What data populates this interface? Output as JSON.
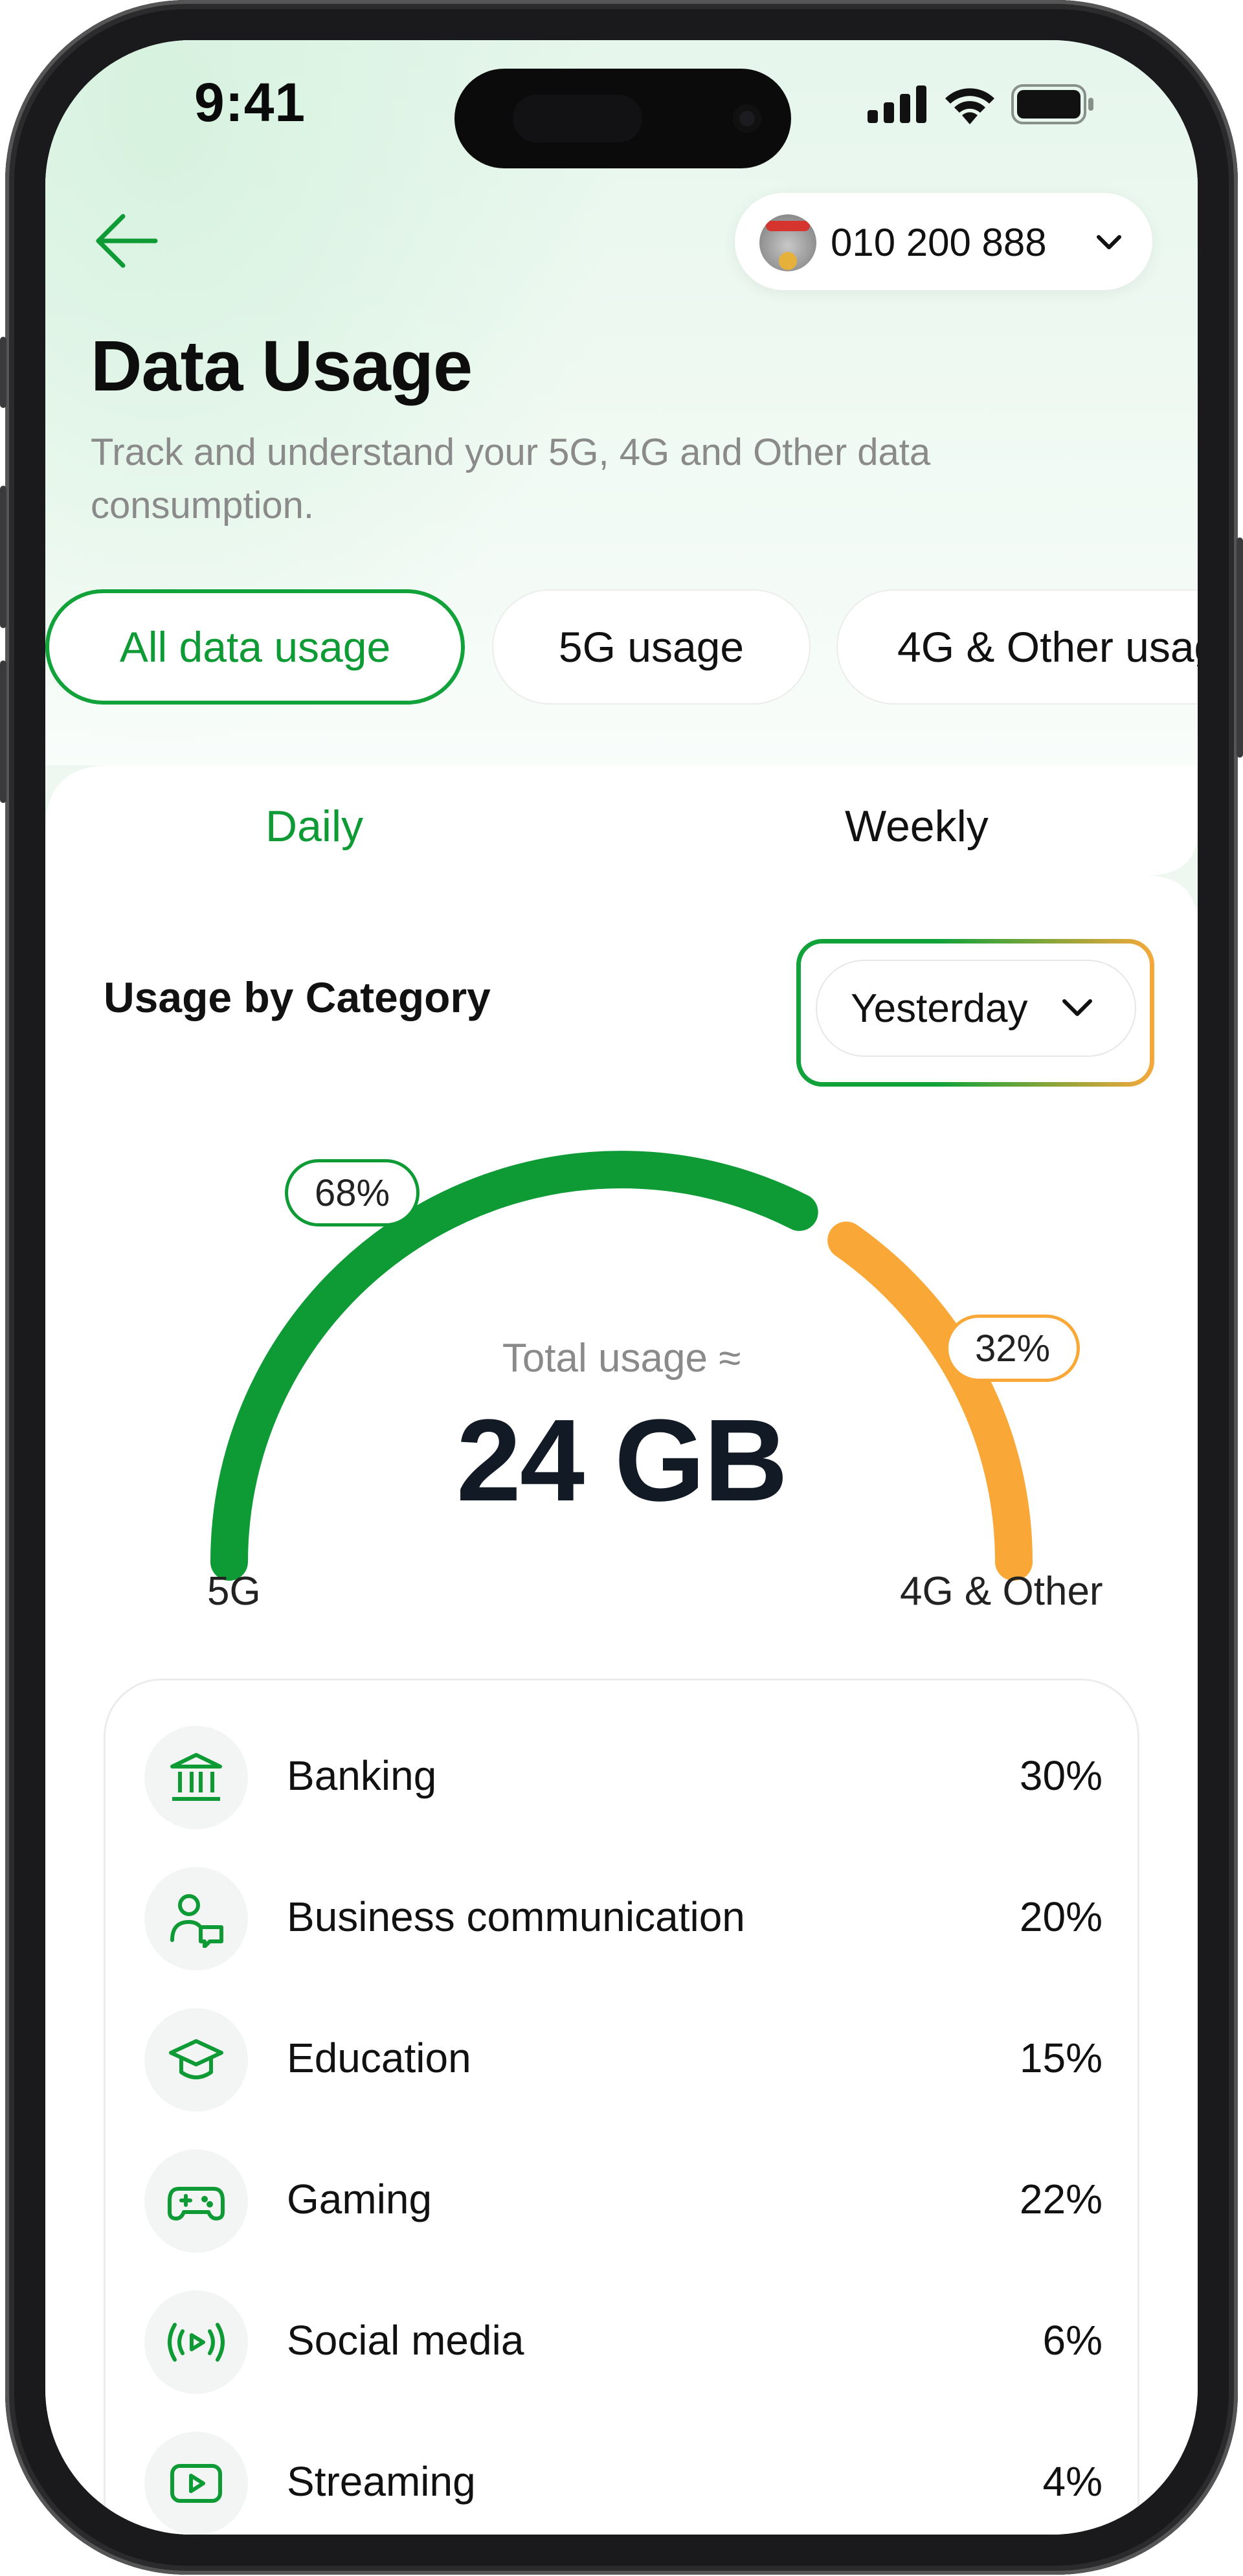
{
  "status_bar": {
    "time": "9:41"
  },
  "header": {
    "phone_number": "010 200 888",
    "title": "Data Usage",
    "subtitle": "Track and understand your 5G, 4G and Other data consumption."
  },
  "filters": [
    {
      "label": "All data usage",
      "active": true
    },
    {
      "label": "5G usage",
      "active": false
    },
    {
      "label": "4G & Other usage",
      "active": false
    }
  ],
  "tabs": [
    {
      "label": "Daily",
      "active": true
    },
    {
      "label": "Weekly",
      "active": false
    }
  ],
  "section": {
    "title": "Usage by Category",
    "period": "Yesterday"
  },
  "gauge": {
    "total_label": "Total usage ≈",
    "total_value": "24 GB",
    "segments": [
      {
        "label": "5G",
        "percent_label": "68%",
        "percent": 68,
        "color": "#0e9a34"
      },
      {
        "label": "4G & Other",
        "percent_label": "32%",
        "percent": 32,
        "color": "#f9a838"
      }
    ]
  },
  "categories": [
    {
      "icon": "bank-icon",
      "label": "Banking",
      "value": "30%"
    },
    {
      "icon": "people-chat-icon",
      "label": "Business communication",
      "value": "20%"
    },
    {
      "icon": "graduation-cap-icon",
      "label": "Education",
      "value": "15%"
    },
    {
      "icon": "gamepad-icon",
      "label": "Gaming",
      "value": "22%"
    },
    {
      "icon": "broadcast-icon",
      "label": "Social media",
      "value": "6%"
    },
    {
      "icon": "play-icon",
      "label": "Streaming",
      "value": "4%"
    }
  ],
  "colors": {
    "accent": "#0e9a34",
    "secondary": "#f9a838",
    "text": "#111111",
    "muted": "#8a8a8a"
  }
}
